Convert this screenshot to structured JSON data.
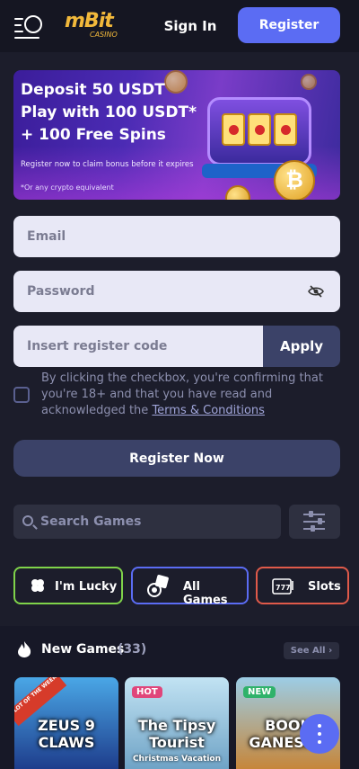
{
  "header": {
    "menu_icon": "mascot-menu-icon",
    "logo_main": "mBit",
    "logo_sub": "CASINO",
    "signin_label": "Sign In",
    "register_label": "Register"
  },
  "banner": {
    "line1": "Deposit 50 USDT",
    "line2": "Play with 100 USDT*",
    "line3": "+ 100 Free Spins",
    "claim": "Register now to claim bonus before it expires",
    "footnote": "*Or any crypto equivalent",
    "coin_symbol": "₿"
  },
  "form": {
    "email_placeholder": "Email",
    "password_placeholder": "Password",
    "code_placeholder": "Insert register code",
    "apply_label": "Apply",
    "consent_text": "By clicking the checkbox, you're confirming that you're 18+ and that you have read and acknowledged the ",
    "terms_link": "Terms & Conditions",
    "submit_label": "Register Now"
  },
  "search": {
    "placeholder": "Search Games",
    "filter_icon": "sliders-icon"
  },
  "categories": [
    {
      "label": "I'm Lucky",
      "icon": "clover-icon",
      "color": "#7fd34a"
    },
    {
      "label": "All Games",
      "icon": "dice-chip-icon",
      "color": "#5b6cf3"
    },
    {
      "label": "Slots",
      "icon": "slot-777-icon",
      "color": "#e05a4a"
    }
  ],
  "new_games": {
    "title": "New Games",
    "count": "(33)",
    "see_all": "See All",
    "cards": [
      {
        "title": "ZEUS 9 CLAWS",
        "badge": "",
        "ribbon": "SLOT OF THE WEEK",
        "sub": ""
      },
      {
        "title": "The Tipsy Tourist",
        "badge": "HOT",
        "ribbon": "",
        "sub": "Christmas Vacation"
      },
      {
        "title": "BOOK GANESHA",
        "badge": "NEW",
        "ribbon": "",
        "sub": ""
      }
    ]
  },
  "colors": {
    "accent": "#5b6cf3",
    "background": "#1c1d2b",
    "brand_gold": "#f2b93b"
  }
}
